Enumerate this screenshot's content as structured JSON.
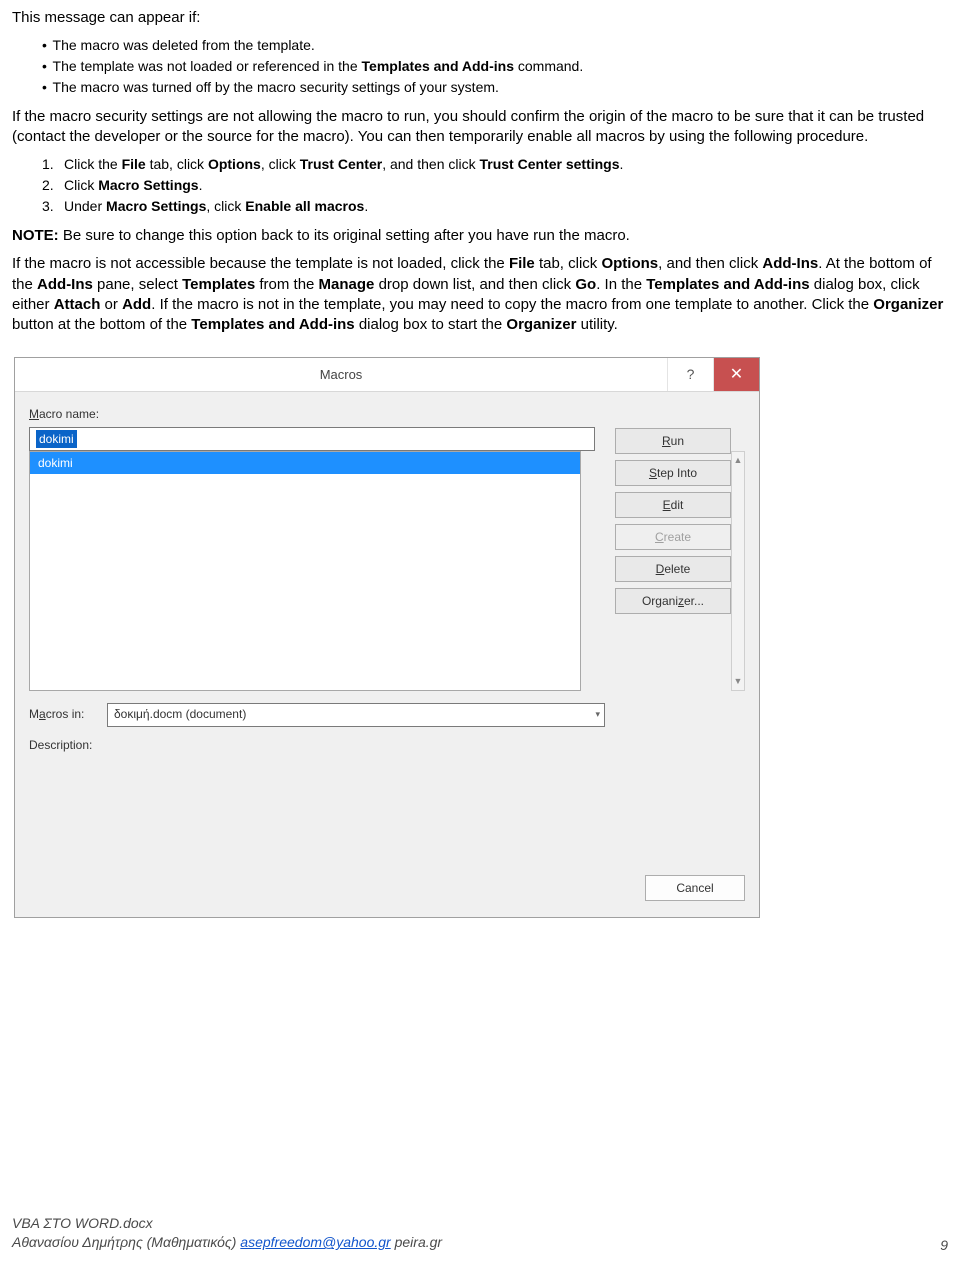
{
  "doc": {
    "intro": "This message can appear if:",
    "bullets": [
      {
        "pre": "",
        "text": "The macro was deleted from the template.",
        "bold": ""
      },
      {
        "pre": "The template was not loaded or referenced in the ",
        "bold": "Templates and Add-ins",
        "post": " command."
      },
      {
        "pre": "",
        "text": "The macro was turned off by the macro security settings of your system.",
        "bold": ""
      }
    ],
    "para2": "If the macro security settings are not allowing the macro to run, you should confirm the origin of the macro to be sure that it can be trusted (contact the developer or the source for the macro). You can then temporarily enable all macros by using the following procedure.",
    "steps": [
      {
        "n": "1.",
        "a": "Click the ",
        "b1": "File",
        "c": " tab, click ",
        "b2": "Options",
        "d": ", click ",
        "b3": "Trust Center",
        "e": ", and then click ",
        "b4": "Trust Center settings",
        "f": "."
      },
      {
        "n": "2.",
        "a": "Click ",
        "b1": "Macro Settings",
        "c": ".",
        "b2": "",
        "d": "",
        "b3": "",
        "e": "",
        "b4": "",
        "f": ""
      },
      {
        "n": "3.",
        "a": "Under ",
        "b1": "Macro Settings",
        "c": ", click ",
        "b2": "Enable all macros",
        "d": ".",
        "b3": "",
        "e": "",
        "b4": "",
        "f": ""
      }
    ],
    "note_label": "NOTE:",
    "note_text": " Be sure to change this option back to its original setting after you have run the macro.",
    "para3": {
      "s1": "If the macro is not accessible because the template is not loaded, click the ",
      "b1": "File",
      "s2": " tab, click ",
      "b2": "Options",
      "s3": ", and then click ",
      "b3": "Add-Ins",
      "s4": ". At the bottom of the ",
      "b4": "Add-Ins",
      "s5": " pane, select ",
      "b5": "Templates",
      "s6": " from the ",
      "b6": "Manage",
      "s7": " drop down list, and then click ",
      "b7": "Go",
      "s8": ". In the ",
      "b8": "Templates and Add-ins",
      "s9": " dialog box, click either ",
      "b9": "Attach",
      "s10": " or ",
      "b10": "Add",
      "s11": ". If the macro is not in the template, you may need to copy the macro from one template to another. Click the ",
      "b11": "Organizer",
      "s12": " button at the bottom of the ",
      "b12": "Templates and Add-ins",
      "s13": " dialog box to start the ",
      "b13": "Organizer",
      "s14": " utility."
    }
  },
  "dialog": {
    "title": "Macros",
    "help_icon": "?",
    "close_icon": "✕",
    "macro_name_label_pre": "",
    "macro_name_label": "acro name:",
    "macro_name_label_u": "M",
    "macro_name_value": "dokimi",
    "list_selected": "dokimi",
    "scroll_up": "▲",
    "scroll_down": "▼",
    "buttons": {
      "run_u": "R",
      "run": "un",
      "step_u": "S",
      "step": "tep Into",
      "edit_u": "E",
      "edit": "dit",
      "create_u": "C",
      "create": "reate",
      "delete_u": "D",
      "delete": "elete",
      "org_pre": "Organi",
      "org_u": "z",
      "org_post": "er..."
    },
    "macros_in_u": "a",
    "macros_in_label_pre": "M",
    "macros_in_label_post": "cros in:",
    "macros_in_value": "δοκιμή.docm (document)",
    "desc_label": "Description:",
    "cancel": "Cancel"
  },
  "footer": {
    "file": "VBA ΣΤΟ WORD.docx",
    "author": "Αθανασίου Δημήτρης (Μαθηματικός) ",
    "email": "asepfreedom@yahoo.gr",
    "site": " peira.gr",
    "page": "9"
  }
}
